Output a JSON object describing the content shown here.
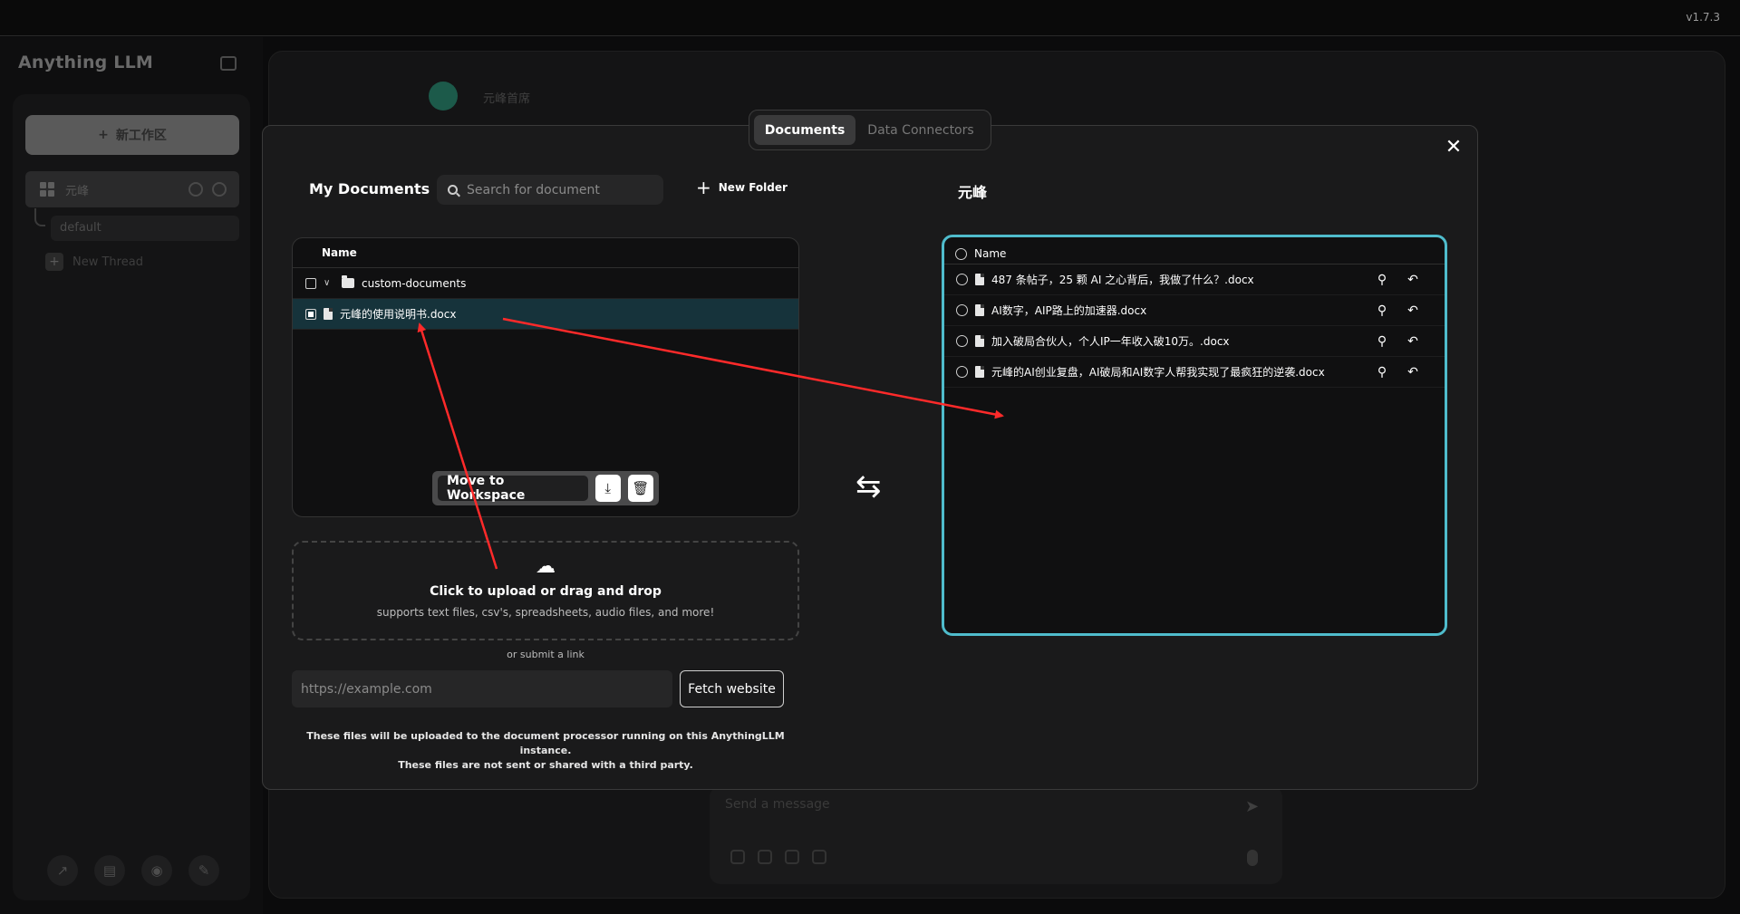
{
  "window": {
    "version": "v1.7.3"
  },
  "sidebar": {
    "logo": "Anything LLM",
    "new_workspace": "新工作区",
    "workspace": "元峰",
    "thread_default": "default",
    "new_thread": "New Thread"
  },
  "chat": {
    "name": "元峰首席",
    "composer_placeholder": "Send a message"
  },
  "modal": {
    "tabs": {
      "documents": "Documents",
      "connectors": "Data Connectors"
    },
    "close": "✕",
    "my_documents": {
      "title": "My Documents",
      "search_placeholder": "Search for document",
      "new_folder": "New Folder",
      "header": "Name",
      "folder": "custom-documents",
      "files": [
        {
          "name": "元峰的使用说明书.docx"
        }
      ]
    },
    "move_bar": {
      "move_label": "Move to Workspace"
    },
    "upload": {
      "title": "Click to upload or drag and drop",
      "subtitle": "supports text files, csv's, spreadsheets, audio files, and more!",
      "or_link": "or submit a link",
      "url_placeholder": "https://example.com",
      "fetch_label": "Fetch website",
      "notice_line1": "These files will be uploaded to the document processor running on this AnythingLLM instance.",
      "notice_line2": "These files are not sent or shared with a third party."
    },
    "workspace_docs": {
      "title": "元峰",
      "header": "Name",
      "files": [
        {
          "name": "487 条帖子，25 颗 AI 之心背后，我做了什么？.docx"
        },
        {
          "name": "AI数字，AIP路上的加速器.docx"
        },
        {
          "name": "加入破局合伙人，个人IP一年收入破10万。.docx"
        },
        {
          "name": "元峰的AI创业复盘，AI破局和AI数字人帮我实现了最疯狂的逆袭.docx"
        }
      ]
    }
  },
  "colors": {
    "accent_border": "#4fbccc",
    "annotation_arrow": "#ff2a2a",
    "selected_row": "#16333b"
  }
}
